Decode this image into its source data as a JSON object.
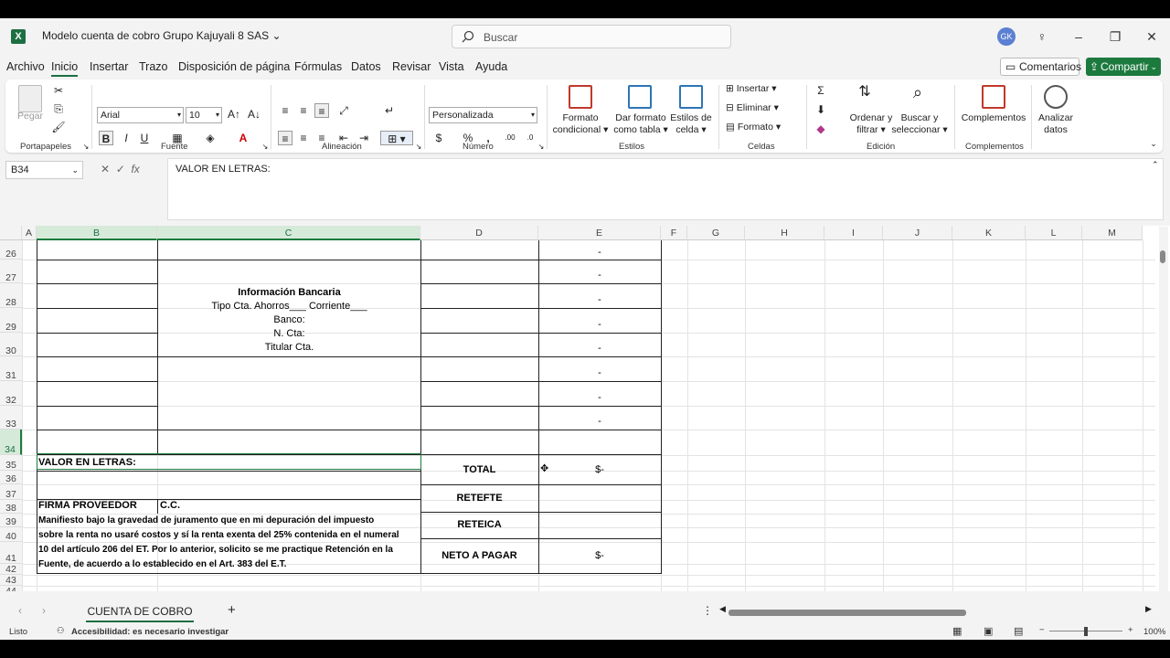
{
  "window": {
    "app_icon": "excel-logo",
    "title": "Modelo cuenta de cobro Grupo Kajuyali 8 SAS",
    "search_placeholder": "Buscar",
    "avatar_initials": "GK"
  },
  "menu": {
    "tabs": [
      "Archivo",
      "Inicio",
      "Insertar",
      "Trazo",
      "Disposición de página",
      "Fórmulas",
      "Datos",
      "Revisar",
      "Vista",
      "Ayuda"
    ],
    "active_tab": "Inicio",
    "comments_label": "Comentarios",
    "share_label": "Compartir"
  },
  "ribbon": {
    "paste_label": "Pegar",
    "font_name": "Arial",
    "font_size": "10",
    "number_format": "Personalizada",
    "cond_format_label": [
      "Formato",
      "condicional"
    ],
    "table_format_label": [
      "Dar formato",
      "como tabla"
    ],
    "cell_styles_label": [
      "Estilos de",
      "celda"
    ],
    "insert_label": "Insertar",
    "delete_label": "Eliminar",
    "format_label": "Formato",
    "sort_label": [
      "Ordenar y",
      "filtrar"
    ],
    "find_label": [
      "Buscar y",
      "seleccionar"
    ],
    "addins_label": "Complementos",
    "analyze_label": [
      "Analizar",
      "datos"
    ],
    "groups": {
      "clipboard": "Portapapeles",
      "font": "Fuente",
      "alignment": "Alineación",
      "number": "Número",
      "styles": "Estilos",
      "cells": "Celdas",
      "editing": "Edición",
      "addins": "Complementos"
    }
  },
  "formula_bar": {
    "name_box": "B34",
    "fx": "fx",
    "content": "VALOR EN LETRAS:"
  },
  "grid": {
    "columns": [
      "A",
      "B",
      "C",
      "D",
      "E",
      "F",
      "G",
      "H",
      "I",
      "J",
      "K",
      "L",
      "M"
    ],
    "rows": [
      "26",
      "27",
      "28",
      "29",
      "30",
      "31",
      "32",
      "33",
      "34",
      "35",
      "36",
      "37",
      "38",
      "39",
      "40",
      "41",
      "42",
      "43",
      "44"
    ],
    "dash": "-",
    "bank_info": {
      "title": "Información Bancaria",
      "line1": "Tipo Cta. Ahorros___ Corriente___",
      "line2": "Banco:",
      "line3": "N. Cta:",
      "line4": "Titular Cta."
    },
    "valor_letras": "VALOR EN LETRAS:",
    "total_label": "TOTAL",
    "total_value": "$-",
    "retefte_label": "RETEFTE",
    "reteica_label": "RETEICA",
    "neto_label": "NETO A PAGAR",
    "neto_value": "$-",
    "firma_label": "FIRMA PROVEEDOR",
    "cc_label": "C.C.",
    "manifiesto": [
      "Manifiesto bajo la gravedad de juramento que en mi depuración del impuesto",
      "sobre la renta no usaré costos y sí la renta exenta del 25% contenida en el numeral",
      "10 del artículo 206 del ET. Por lo anterior, solicito se me practique Retención en la",
      "Fuente, de acuerdo a lo establecido en el Art. 383 del E.T."
    ]
  },
  "sheets": {
    "active": "CUENTA DE COBRO",
    "add": "+"
  },
  "status": {
    "ready": "Listo",
    "accessibility": "Accesibilidad: es necesario investigar",
    "zoom": "100%"
  }
}
